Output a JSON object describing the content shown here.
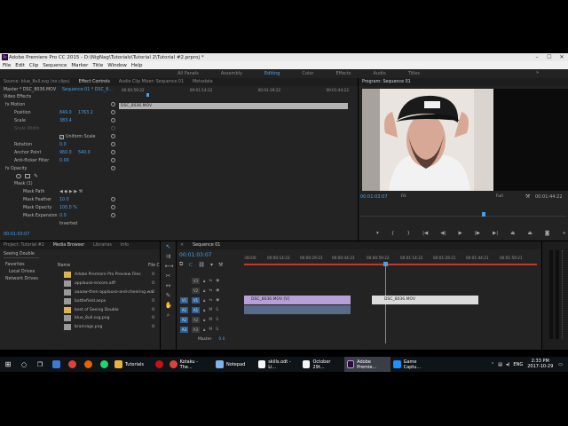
{
  "window": {
    "title": "Adobe Premiere Pro CC 2015 - D:\\NigNag\\Tutorials\\Tutorial 2\\Tutorial #2.prproj *",
    "app_icon": "Pr"
  },
  "menu": [
    "File",
    "Edit",
    "Clip",
    "Sequence",
    "Marker",
    "Title",
    "Window",
    "Help"
  ],
  "workspaces": [
    {
      "label": "All Panels",
      "active": false
    },
    {
      "label": "Assembly",
      "active": false
    },
    {
      "label": "Editing",
      "active": true
    },
    {
      "label": "Color",
      "active": false
    },
    {
      "label": "Effects",
      "active": false
    },
    {
      "label": "Audio",
      "active": false
    },
    {
      "label": "Titles",
      "active": false
    }
  ],
  "effect_panel": {
    "tabs": [
      "Source: blue_8ull.svg (no clips)",
      "Effect Controls",
      "Audio Clip Mixer: Sequence 01",
      "Metadata"
    ],
    "active_tab": "Effect Controls",
    "clip_header": "Master * DSC_8036.MOV",
    "seq_header": "Sequence 01 * DSC_8...",
    "ruler": [
      "00:00:59:22",
      "00:01:14:22",
      "00:01:29:22",
      "00:01:44:22"
    ],
    "clip_bar": "DSC_8036.MOV",
    "section": "Video Effects",
    "rows": [
      {
        "label": "fx  Motion",
        "value": "",
        "value2": ""
      },
      {
        "label": "Position",
        "value": "849.0",
        "value2": "1763.2"
      },
      {
        "label": "Scale",
        "value": "383.4",
        "value2": ""
      },
      {
        "label": "Scale Width",
        "value": "",
        "value2": ""
      },
      {
        "label": "Uniform Scale",
        "value": "",
        "value2": ""
      },
      {
        "label": "Rotation",
        "value": "0.0",
        "value2": ""
      },
      {
        "label": "Anchor Point",
        "value": "960.0",
        "value2": "540.0"
      },
      {
        "label": "Anti-flicker Filter",
        "value": "0.00",
        "value2": ""
      },
      {
        "label": "fx  Opacity",
        "value": "",
        "value2": ""
      },
      {
        "label": "Mask (1)",
        "value": "",
        "value2": ""
      },
      {
        "label": "Mask Path",
        "value": "",
        "value2": ""
      },
      {
        "label": "Mask Feather",
        "value": "10.0",
        "value2": ""
      },
      {
        "label": "Mask Opacity",
        "value": "100.0 %",
        "value2": ""
      },
      {
        "label": "Mask Expansion",
        "value": "0.0",
        "value2": ""
      },
      {
        "label": "Inverted",
        "value": "",
        "value2": ""
      }
    ],
    "timecode": "00:01:03:07"
  },
  "program_monitor": {
    "title": "Program: Sequence 01",
    "timecode_left": "00:01:03:07",
    "fit": "Fit",
    "quality": "Full",
    "timecode_right": "00:01:44:22"
  },
  "project_panel": {
    "tabs": [
      "Project: Tutorial #2",
      "Media Browser",
      "Libraries",
      "Info"
    ],
    "active_tab": "Media Browser",
    "location": "Seeing Double",
    "tree": [
      "Favorites",
      "Local Drives",
      "Network Drives"
    ],
    "col_name": "Name",
    "col_count": "File C",
    "files": [
      {
        "name": "Adobe Premiere Pro Preview Files",
        "count": "0"
      },
      {
        "name": "applause-encore.aiff",
        "count": "0"
      },
      {
        "name": "aaaaw-then-applause-and-cheering.wa",
        "count": "0"
      },
      {
        "name": "battlefield.aepx",
        "count": "0"
      },
      {
        "name": "best of Seeing Double",
        "count": "0"
      },
      {
        "name": "blue_8ull.svg.png",
        "count": "0"
      },
      {
        "name": "brainrags.png",
        "count": "0"
      }
    ]
  },
  "sequence": {
    "tab": "Sequence 01",
    "timecode": "00:01:03:07",
    "ruler": [
      ":00:00",
      "00:00:14:23",
      "00:00:29:23",
      "00:00:44:23",
      "00:00:59:22",
      "00:01:14:22",
      "00:01:29:21",
      "00:01:44:21",
      "00:01:59:21"
    ],
    "tracks": [
      {
        "id": "V3",
        "kind": "video"
      },
      {
        "id": "V2",
        "kind": "video"
      },
      {
        "id": "V1",
        "kind": "video"
      },
      {
        "id": "A1",
        "kind": "audio"
      },
      {
        "id": "A2",
        "kind": "audio"
      },
      {
        "id": "A3",
        "kind": "audio"
      }
    ],
    "master_label": "Master",
    "master_value": "0.0",
    "clips": [
      {
        "label": "DSC_8036.MOV [V]"
      },
      {
        "label": "DSC_8036.MOV"
      }
    ]
  },
  "taskbar": {
    "items": [
      {
        "label": "",
        "icon": "windows-icon"
      },
      {
        "label": "",
        "icon": "search-icon"
      },
      {
        "label": "",
        "icon": "task-view-icon"
      },
      {
        "label": "",
        "icon": "store-icon"
      },
      {
        "label": "",
        "icon": "chrome-icon"
      },
      {
        "label": "",
        "icon": "firefox-icon"
      },
      {
        "label": "",
        "icon": "whatsapp-icon"
      },
      {
        "label": "Tutorials",
        "icon": "folder-icon"
      },
      {
        "label": "",
        "icon": "opera-icon"
      },
      {
        "label": "Kotaku - The...",
        "icon": "chrome-icon"
      },
      {
        "label": "Notepad",
        "icon": "notepad-icon"
      },
      {
        "label": "skills.odt - Li...",
        "icon": "writer-icon"
      },
      {
        "label": "October 29t...",
        "icon": "writer-icon"
      },
      {
        "label": "Adobe Premie...",
        "icon": "premiere-icon"
      },
      {
        "label": "Game Captu...",
        "icon": "capture-icon"
      }
    ],
    "lang": "ENG",
    "time": "2:33 PM",
    "date": "2017-10-29"
  }
}
